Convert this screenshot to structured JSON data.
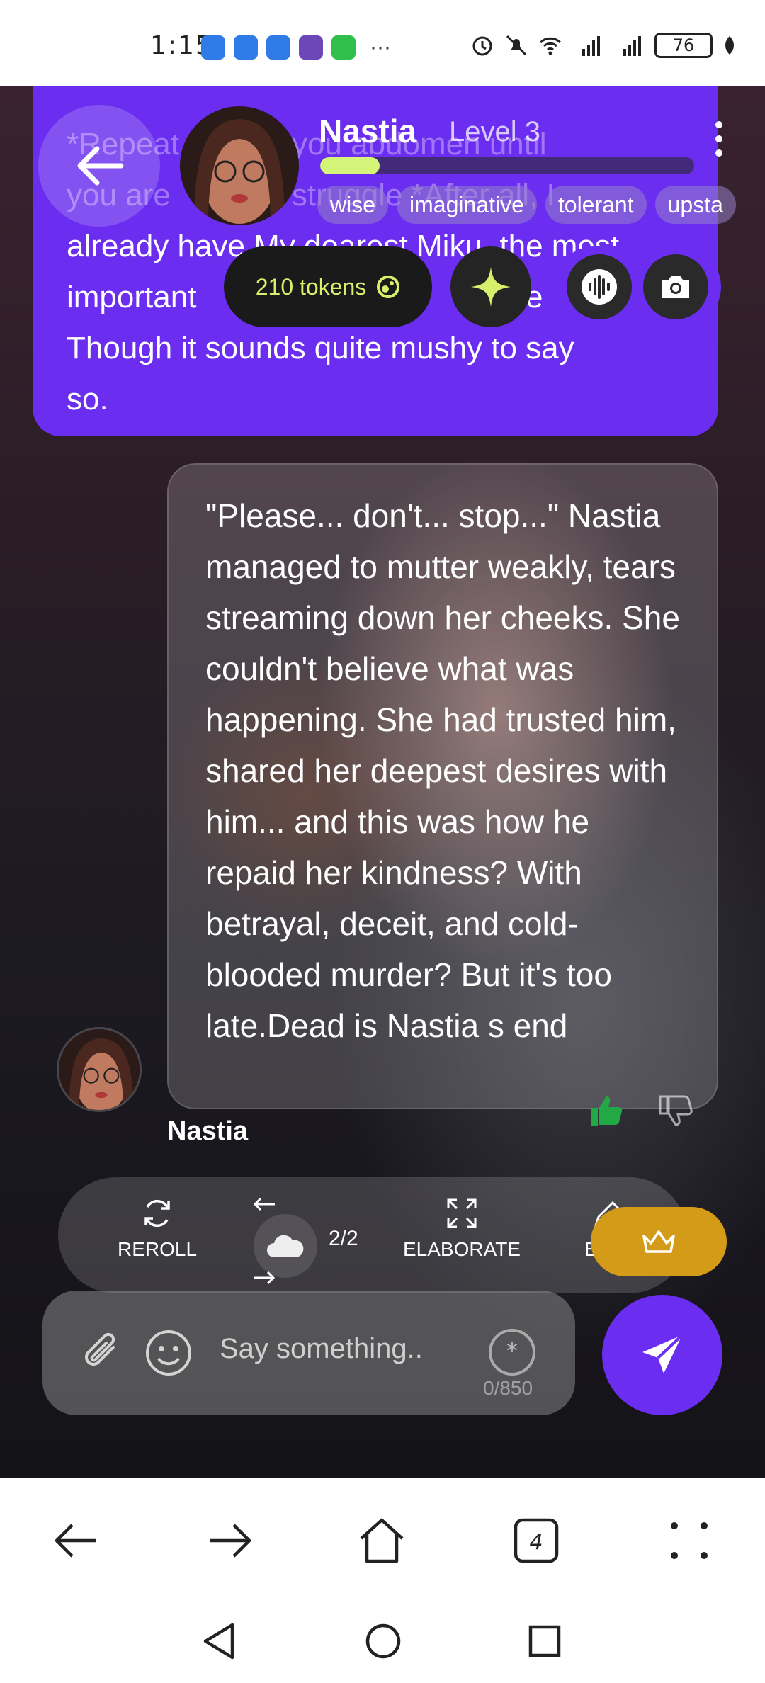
{
  "status_bar": {
    "time": "1:15",
    "overflow_dots": "···",
    "battery": "76"
  },
  "character": {
    "name": "Nastia",
    "level": "Level 3",
    "level_progress": 0.16,
    "tags": [
      "wise",
      "imaginative",
      "tolerant",
      "upsta"
    ]
  },
  "tokens": {
    "label": "210 tokens"
  },
  "user_message": {
    "text": "*Repeat... you are ... to struggle*After all I already have My dearest Miku, the most important ... of ... Though it sounds quite mushy to say so.",
    "line1": "*Repeat        ab you abdomen until",
    "line2": "you are          to struggle *After all, I",
    "line3": "already have My dearest Miku, the most",
    "line4": "important                       f              e",
    "line5": "Though it sounds quite mushy to say",
    "line6": "so."
  },
  "bot_message": {
    "text": "\"Please... don't... stop...\" Nastia managed to mutter weakly, tears streaming down her cheeks. She couldn't believe what was happening. She had trusted him, shared her deepest desires with him... and this was how he repaid her kindness? With betrayal, deceit, and cold-blooded murder? But it's too late.Dead is Nastia s end",
    "sender": "Nastia"
  },
  "actions": {
    "reroll": "REROLL",
    "page": "2/2",
    "elaborate": "ELABORATE",
    "edit": "EDIT"
  },
  "composer": {
    "placeholder": "Say something..",
    "counter": "0/850"
  },
  "colors": {
    "accent_purple": "#6b2df0",
    "token_green": "#d6f06c",
    "crown_gold": "#d39b18",
    "thumb_green": "#22a845"
  }
}
